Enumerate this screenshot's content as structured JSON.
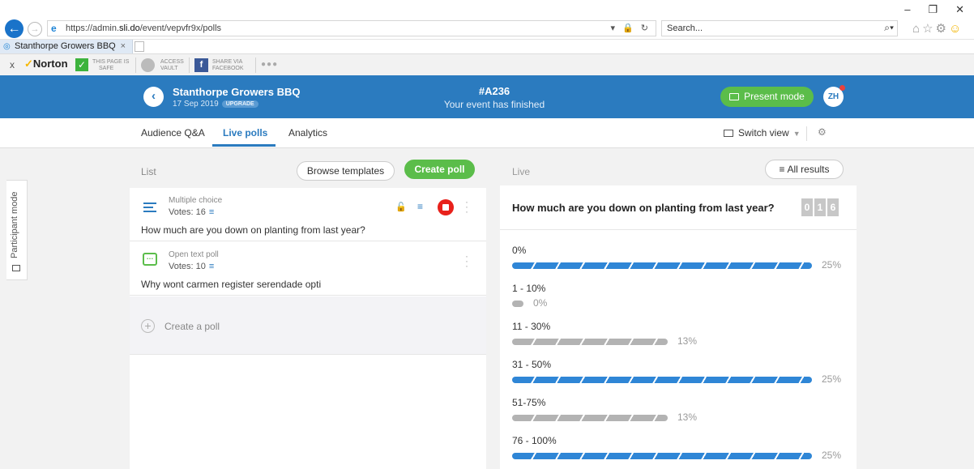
{
  "browser": {
    "url_prefix": "https://admin.",
    "url_domain": "sli.do",
    "url_path": "/event/vepvfr9x/polls",
    "search_placeholder": "Search...",
    "tab_title": "Stanthorpe Growers BBQ",
    "tab_close": "×"
  },
  "norton": {
    "close": "x",
    "logo": "Norton",
    "safe_line1": "THIS PAGE IS",
    "safe_line2": "SAFE",
    "vault_line1": "ACCESS",
    "vault_line2": "VAULT",
    "fb_line1": "SHARE VIA",
    "fb_line2": "FACEBOOK"
  },
  "header": {
    "event_name": "Stanthorpe Growers BBQ",
    "event_date": "17 Sep 2019",
    "upgrade": "UPGRADE",
    "event_code": "#A236",
    "event_status": "Your event has finished",
    "present_label": "Present mode",
    "avatar": "ZH"
  },
  "nav": {
    "tabs": [
      "Audience Q&A",
      "Live polls",
      "Analytics"
    ],
    "switch_view": "Switch view"
  },
  "participant_mode": "Participant mode",
  "list": {
    "label": "List",
    "browse_templates": "Browse templates",
    "create_poll": "Create poll",
    "polls": [
      {
        "type": "Multiple choice",
        "votes": "Votes: 16",
        "question": "How much are you down on planting from last year?"
      },
      {
        "type": "Open text poll",
        "votes": "Votes: 10",
        "question": "Why wont carmen register serendade opti"
      }
    ],
    "create_a_poll": "Create a poll"
  },
  "live": {
    "label": "Live",
    "all_results": "All results",
    "question": "How much are you down on planting from last year?",
    "counter": [
      "0",
      "1",
      "6"
    ],
    "options": [
      {
        "label": "0%",
        "percent": "25%",
        "value": 25,
        "color": "blue"
      },
      {
        "label": "1 - 10%",
        "percent": "0%",
        "value": 0,
        "color": "grey"
      },
      {
        "label": "11 - 30%",
        "percent": "13%",
        "value": 13,
        "color": "grey"
      },
      {
        "label": "31 - 50%",
        "percent": "25%",
        "value": 25,
        "color": "blue"
      },
      {
        "label": "51-75%",
        "percent": "13%",
        "value": 13,
        "color": "grey"
      },
      {
        "label": "76 - 100%",
        "percent": "25%",
        "value": 25,
        "color": "blue"
      }
    ]
  },
  "colors": {
    "brand_blue": "#2b7bbf",
    "green": "#5bbd4a",
    "stop_red": "#e8211b"
  }
}
